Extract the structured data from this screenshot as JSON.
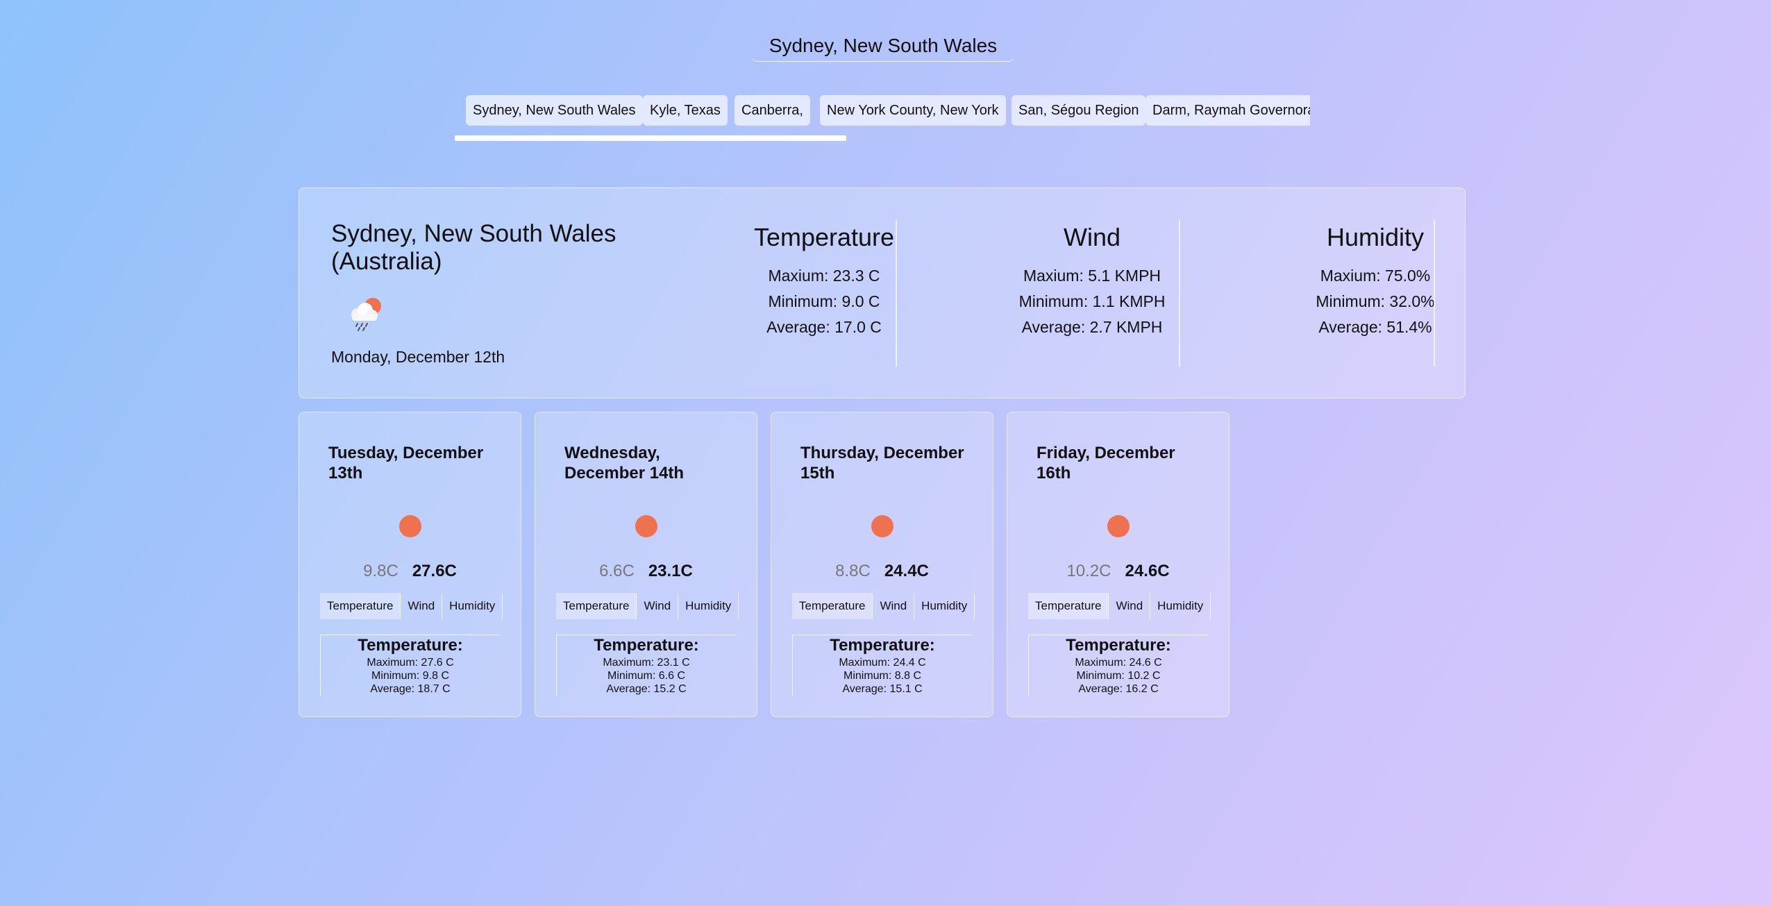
{
  "search": {
    "value": "Sydney, New South Wales"
  },
  "recent_tabs": [
    "Sydney, New South Wales",
    "Kyle, Texas",
    "Canberra,",
    "New York County, New York",
    "San, Ségou Region",
    "Darm, Raymah Governorate"
  ],
  "today": {
    "city": "Sydney, New South Wales (Australia)",
    "date": "Monday, December 12th",
    "icon": "sun-behind-rain-cloud-icon",
    "temperature": {
      "title": "Temperature",
      "max": "Maxium: 23.3 C",
      "min": "Minimum: 9.0 C",
      "avg": "Average: 17.0 C"
    },
    "wind": {
      "title": "Wind",
      "max": "Maxium: 5.1 KMPH",
      "min": "Minimum: 1.1 KMPH",
      "avg": "Average: 2.7 KMPH"
    },
    "humidity": {
      "title": "Humidity",
      "max": "Maxium: 75.0%",
      "min": "Minimum: 32.0%",
      "avg": "Average: 51.4%"
    }
  },
  "forecast_tab_labels": [
    "Temperature",
    "Wind",
    "Humidity"
  ],
  "forecast": [
    {
      "day": "Tuesday, December 13th",
      "low": "9.8C",
      "high": "27.6C",
      "detail": {
        "title": "Temperature:",
        "max": "Maximum: 27.6 C",
        "min": "Minimum: 9.8 C",
        "avg": "Average: 18.7 C"
      }
    },
    {
      "day": "Wednesday, December 14th",
      "low": "6.6C",
      "high": "23.1C",
      "detail": {
        "title": "Temperature:",
        "max": "Maximum: 23.1 C",
        "min": "Minimum: 6.6 C",
        "avg": "Average: 15.2 C"
      }
    },
    {
      "day": "Thursday, December 15th",
      "low": "8.8C",
      "high": "24.4C",
      "detail": {
        "title": "Temperature:",
        "max": "Maximum: 24.4 C",
        "min": "Minimum: 8.8 C",
        "avg": "Average: 15.1 C"
      }
    },
    {
      "day": "Friday, December 16th",
      "low": "10.2C",
      "high": "24.6C",
      "detail": {
        "title": "Temperature:",
        "max": "Maximum: 24.6 C",
        "min": "Minimum: 10.2 C",
        "avg": "Average: 16.2 C"
      }
    }
  ],
  "colors": {
    "sun": "#ee7150",
    "low_temp_text": "#777777"
  },
  "forecast_icon": "sun-icon"
}
